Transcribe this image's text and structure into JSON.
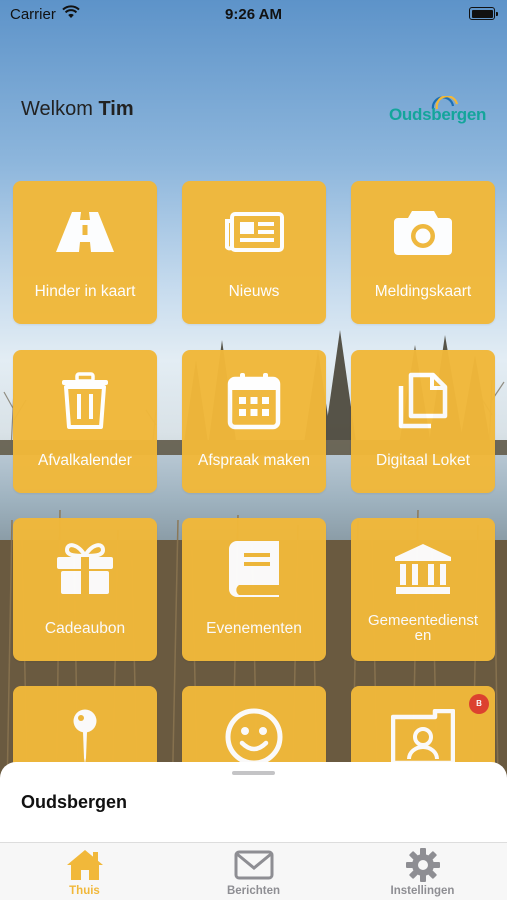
{
  "status_bar": {
    "carrier": "Carrier",
    "time": "9:26 AM"
  },
  "header": {
    "welcome_prefix": "Welkom",
    "user_name": "Tim",
    "logo_text": "Oudsbergen"
  },
  "tiles": [
    {
      "label": "Hinder in kaart",
      "icon": "road-icon"
    },
    {
      "label": "Nieuws",
      "icon": "newspaper-icon"
    },
    {
      "label": "Meldingskaart",
      "icon": "camera-icon"
    },
    {
      "label": "Afvalkalender",
      "icon": "trash-icon"
    },
    {
      "label": "Afspraak maken",
      "icon": "calendar-icon"
    },
    {
      "label": "Digitaal Loket",
      "icon": "documents-icon"
    },
    {
      "label": "Cadeaubon",
      "icon": "gift-icon"
    },
    {
      "label": "Evenementen",
      "icon": "book-icon"
    },
    {
      "label": "Gemeentediensten",
      "label_line1": "Gemeentedienst",
      "label_line2": "en",
      "icon": "building-icon"
    },
    {
      "label": "",
      "icon": "pin-icon"
    },
    {
      "label": "",
      "icon": "smiley-icon"
    },
    {
      "label": "",
      "icon": "id-photo-icon",
      "badge": "B"
    }
  ],
  "sheet": {
    "title": "Oudsbergen"
  },
  "tabbar": {
    "items": [
      {
        "label": "Thuis",
        "icon": "home-icon",
        "active": true
      },
      {
        "label": "Berichten",
        "icon": "envelope-icon",
        "active": false
      },
      {
        "label": "Instellingen",
        "icon": "gear-icon",
        "active": false
      }
    ]
  },
  "colors": {
    "tile": "#f1b83a",
    "brand_teal": "#14a59b",
    "tab_active": "#f1b83a",
    "tab_inactive": "#8e8e93"
  }
}
